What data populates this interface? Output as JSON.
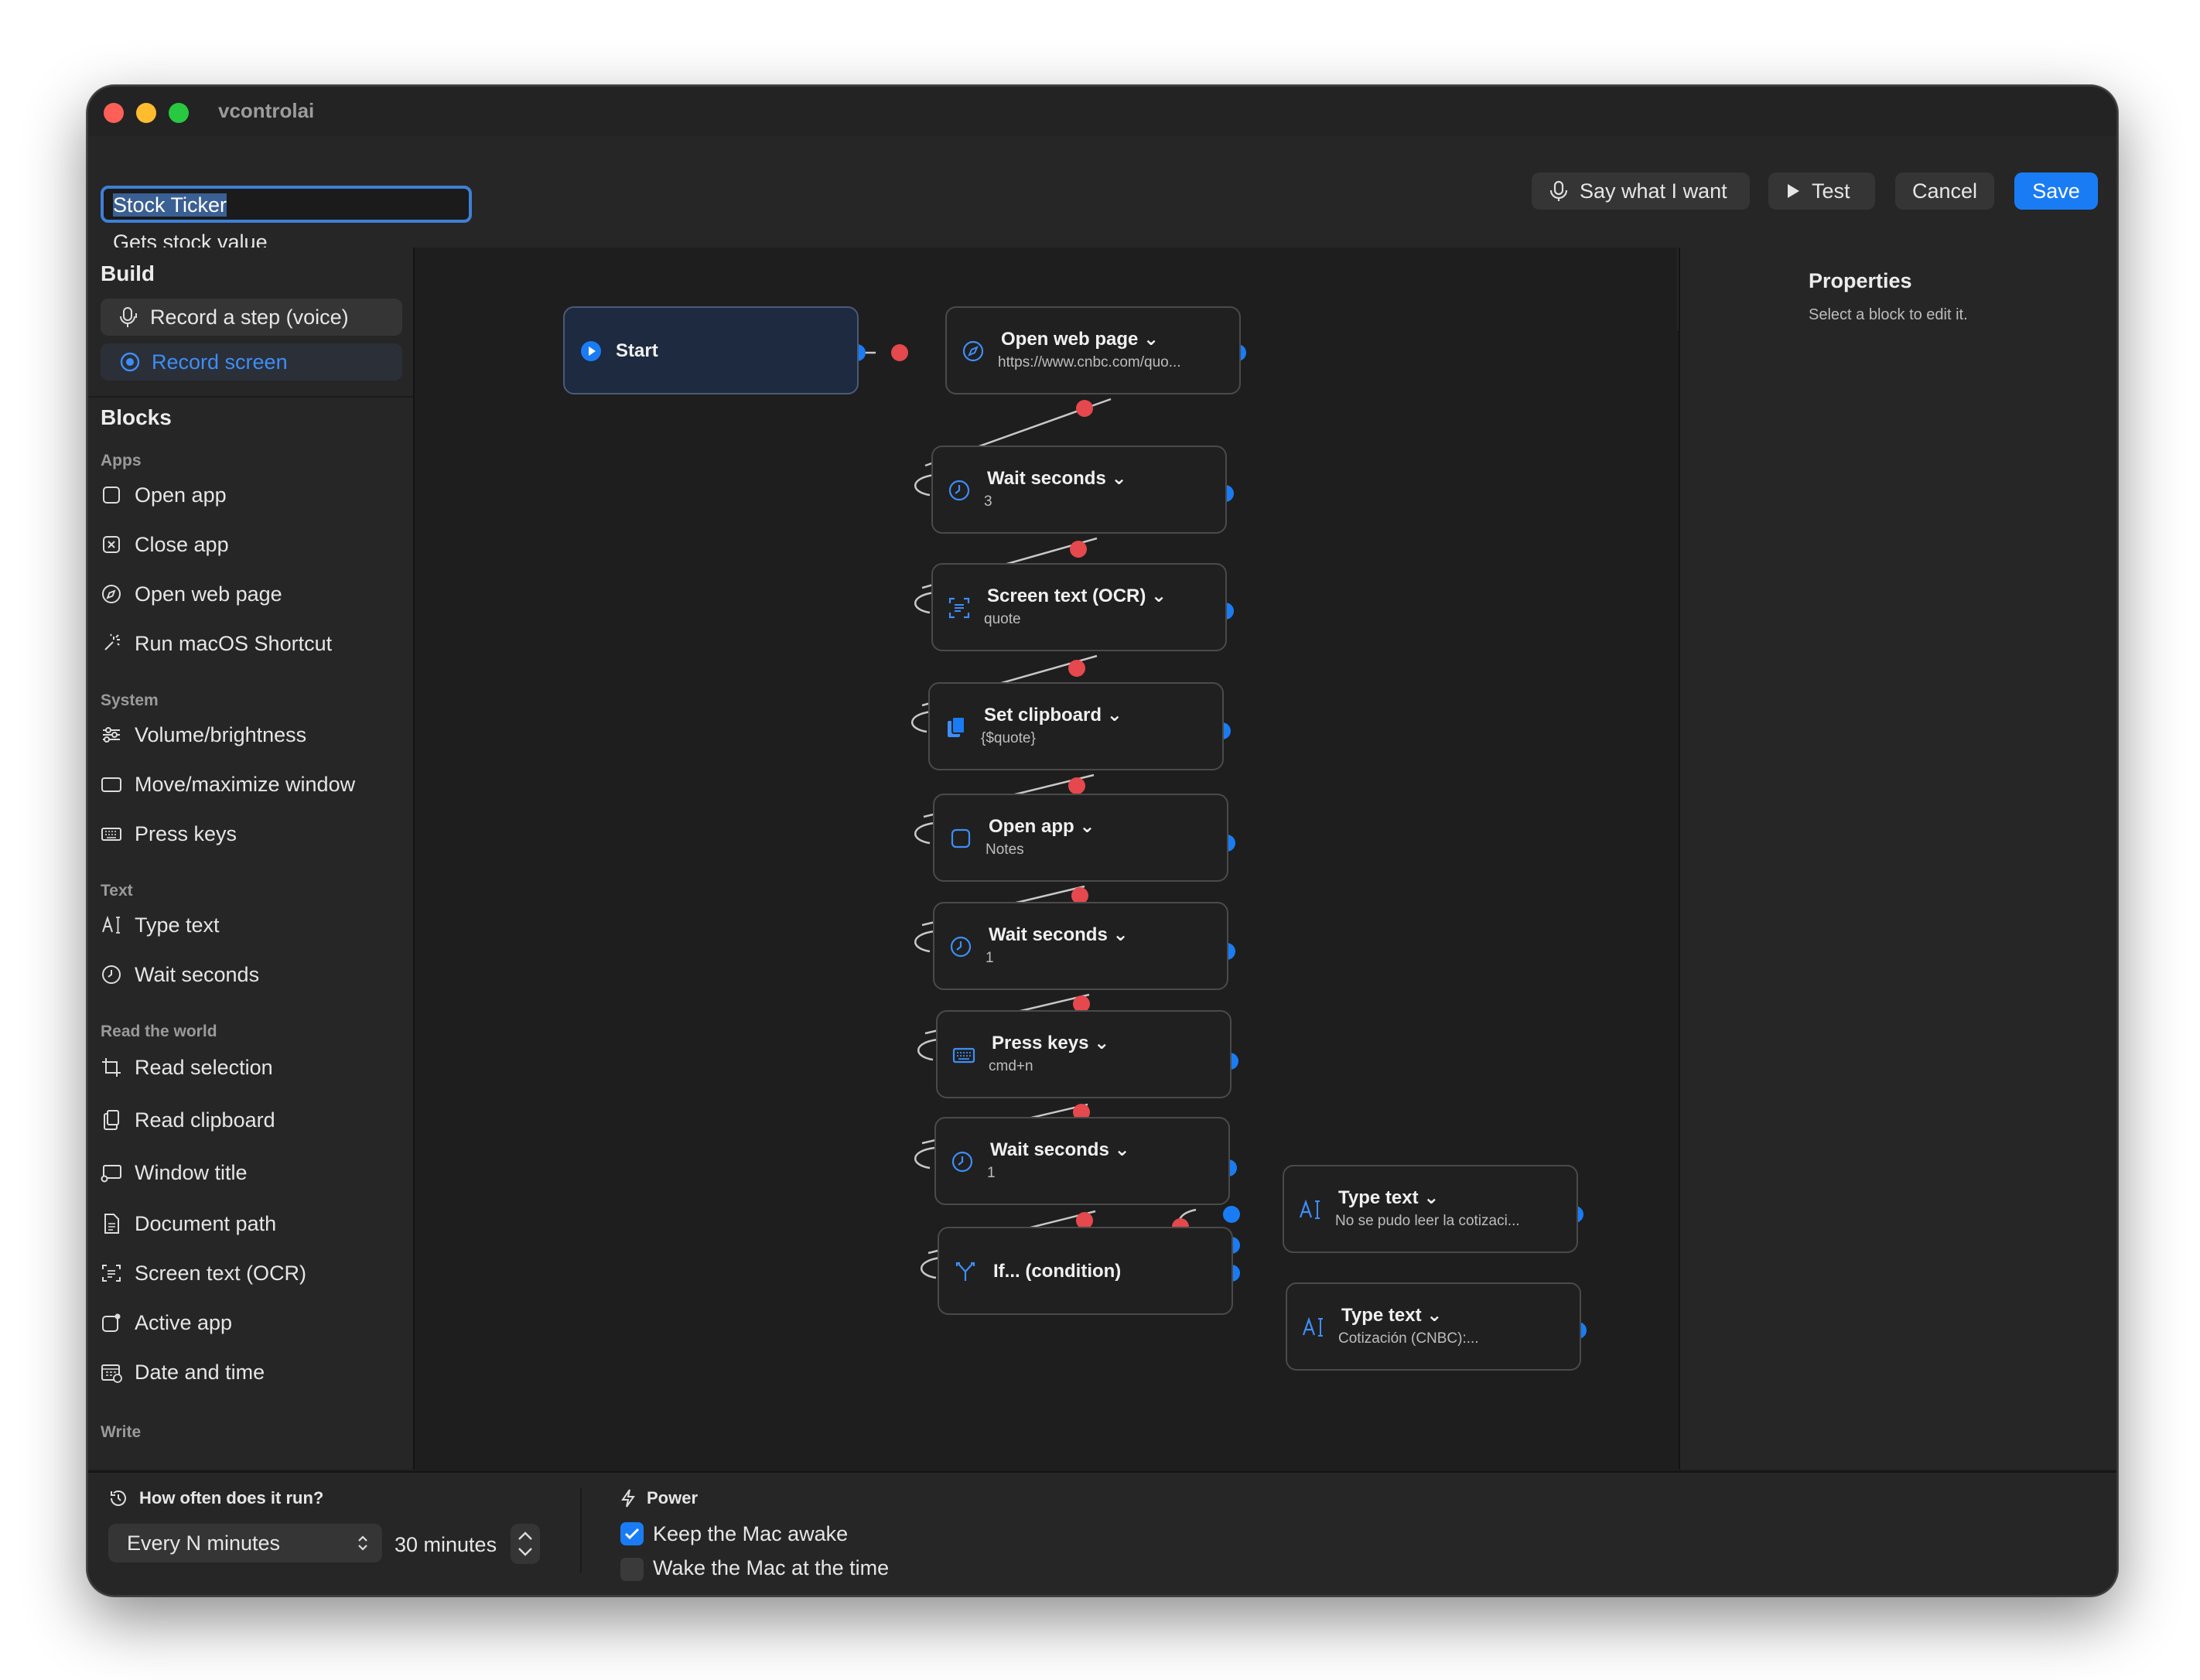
{
  "window": {
    "title": "vcontrolai"
  },
  "automation": {
    "name": "Stock Ticker",
    "description": "Gets stock value"
  },
  "toolbar": {
    "say": "Say what I want",
    "test": "Test",
    "cancel": "Cancel",
    "save": "Save"
  },
  "sidebar": {
    "build_heading": "Build",
    "record_voice": "Record a step (voice)",
    "record_screen": "Record screen",
    "blocks_heading": "Blocks",
    "categories": [
      "Apps",
      "System",
      "Text",
      "Read the world",
      "Write"
    ],
    "items": [
      {
        "label": "Open app",
        "icon": "app-square-icon"
      },
      {
        "label": "Close app",
        "icon": "close-app-icon"
      },
      {
        "label": "Open web page",
        "icon": "compass-icon"
      },
      {
        "label": "Run macOS Shortcut",
        "icon": "shortcut-icon"
      },
      {
        "label": "Volume/brightness",
        "icon": "sliders-icon"
      },
      {
        "label": "Move/maximize window",
        "icon": "window-icon"
      },
      {
        "label": "Press keys",
        "icon": "keyboard-icon"
      },
      {
        "label": "Type text",
        "icon": "text-cursor-icon"
      },
      {
        "label": "Wait seconds",
        "icon": "clock-icon"
      },
      {
        "label": "Read selection",
        "icon": "crop-icon"
      },
      {
        "label": "Read clipboard",
        "icon": "clipboard-icon"
      },
      {
        "label": "Window title",
        "icon": "window-title-icon"
      },
      {
        "label": "Document path",
        "icon": "document-icon"
      },
      {
        "label": "Screen text (OCR)",
        "icon": "ocr-icon"
      },
      {
        "label": "Active app",
        "icon": "active-app-icon"
      },
      {
        "label": "Date and time",
        "icon": "calendar-icon"
      }
    ]
  },
  "nodes": [
    {
      "id": "start",
      "title": "Start",
      "sub": ""
    },
    {
      "id": "n1",
      "title": "Open web page ⌄",
      "sub": "https://www.cnbc.com/quo..."
    },
    {
      "id": "n2",
      "title": "Wait seconds ⌄",
      "sub": "3"
    },
    {
      "id": "n3",
      "title": "Screen text (OCR) ⌄",
      "sub": "quote"
    },
    {
      "id": "n4",
      "title": "Set clipboard ⌄",
      "sub": "{$quote}"
    },
    {
      "id": "n5",
      "title": "Open app ⌄",
      "sub": "Notes"
    },
    {
      "id": "n6",
      "title": "Wait seconds ⌄",
      "sub": "1"
    },
    {
      "id": "n7",
      "title": "Press keys ⌄",
      "sub": "cmd+n"
    },
    {
      "id": "n8",
      "title": "Wait seconds ⌄",
      "sub": "1"
    },
    {
      "id": "n9",
      "title": "If... (condition)",
      "sub": ""
    },
    {
      "id": "n10",
      "title": "Type text ⌄",
      "sub": "No se pudo leer la cotizaci..."
    },
    {
      "id": "n11",
      "title": "Type text ⌄",
      "sub": "Cotización (CNBC):..."
    }
  ],
  "properties": {
    "title": "Properties",
    "hint": "Select a block to edit it."
  },
  "schedule": {
    "heading": "How often does it run?",
    "mode": "Every N minutes",
    "interval": "30 minutes"
  },
  "power": {
    "heading": "Power",
    "keep_awake": "Keep the Mac awake",
    "keep_awake_checked": true,
    "wake": "Wake the Mac at the time",
    "wake_checked": false
  },
  "colors": {
    "accent": "#1a7cf5",
    "connector_dot": "#e5484d",
    "port": "#1a7cf5"
  }
}
